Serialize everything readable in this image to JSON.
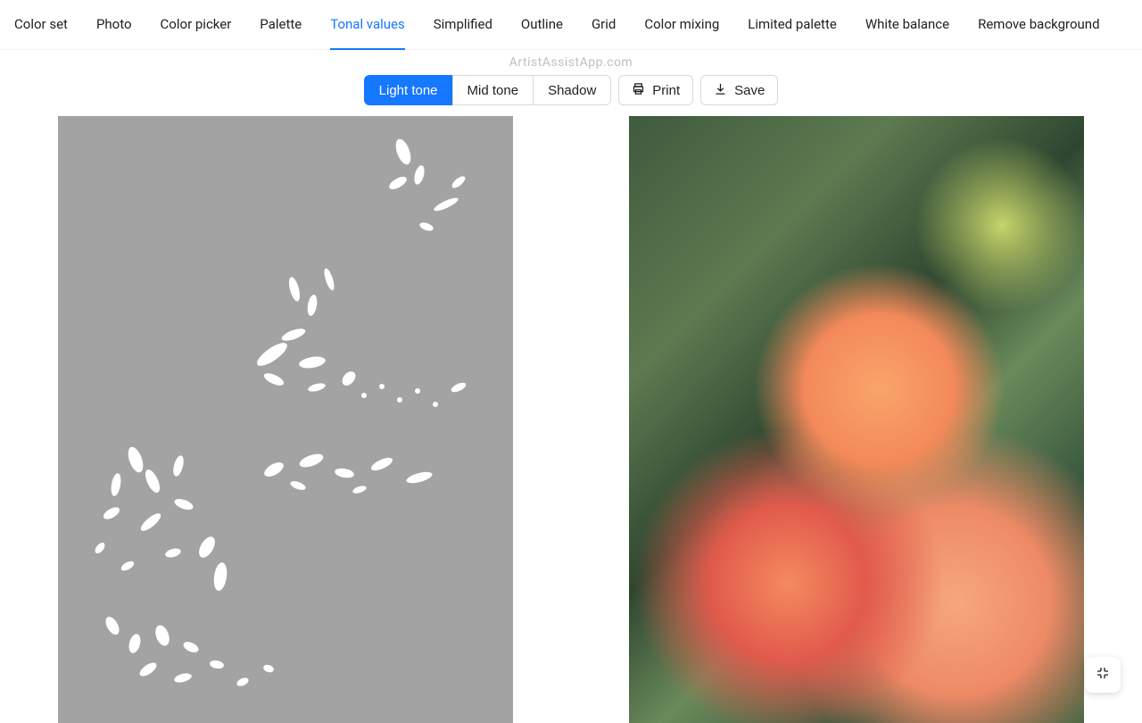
{
  "tabs": [
    {
      "label": "Color set"
    },
    {
      "label": "Photo"
    },
    {
      "label": "Color picker"
    },
    {
      "label": "Palette"
    },
    {
      "label": "Tonal values",
      "active": true
    },
    {
      "label": "Simplified"
    },
    {
      "label": "Outline"
    },
    {
      "label": "Grid"
    },
    {
      "label": "Color mixing"
    },
    {
      "label": "Limited palette"
    },
    {
      "label": "White balance"
    },
    {
      "label": "Remove background"
    }
  ],
  "watermark": "ArtistAssistApp.com",
  "tone_buttons": {
    "light": "Light tone",
    "mid": "Mid tone",
    "shadow": "Shadow",
    "active": "light"
  },
  "actions": {
    "print": "Print",
    "save": "Save"
  },
  "float_button": "compress-icon"
}
